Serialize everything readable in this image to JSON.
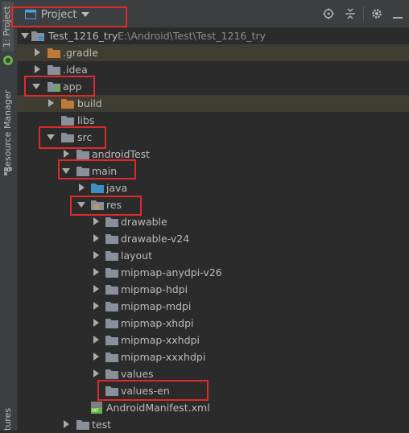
{
  "side_tabs": {
    "project": "1: Project",
    "resource_manager": "Resource Manager",
    "structure": "tures"
  },
  "toolbar": {
    "view_label": "Project"
  },
  "tree": {
    "root_name": "Test_1216_try",
    "root_path": "E:\\Android\\Test\\Test_1216_try",
    "gradle": ".gradle",
    "idea": ".idea",
    "app": "app",
    "build": "build",
    "libs": "libs",
    "src": "src",
    "android_test": "androidTest",
    "main": "main",
    "java": "java",
    "res": "res",
    "res_children": [
      "drawable",
      "drawable-v24",
      "layout",
      "mipmap-anydpi-v26",
      "mipmap-hdpi",
      "mipmap-mdpi",
      "mipmap-xhdpi",
      "mipmap-xxhdpi",
      "mipmap-xxxhdpi",
      "values",
      "values-en"
    ],
    "manifest": "AndroidManifest.xml",
    "manifest_badge": "MF",
    "test": "test"
  },
  "colors": {
    "highlight_box": "#e02a2a",
    "folder": "#8a9099",
    "folder_orange": "#c0773a",
    "folder_blue": "#3d8fc4",
    "module_green": "#62b543"
  }
}
